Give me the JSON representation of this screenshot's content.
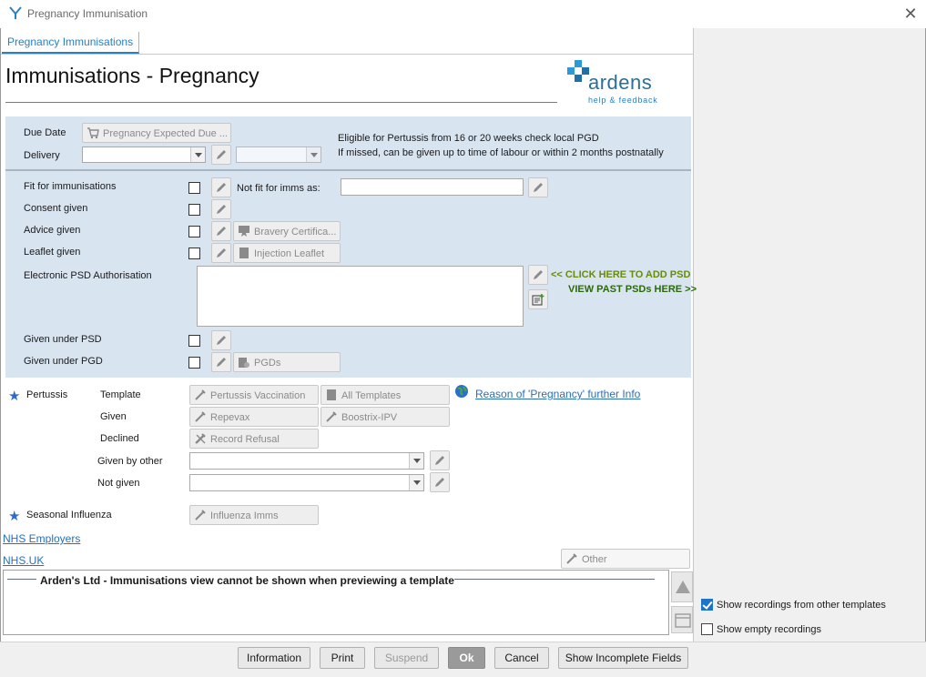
{
  "window": {
    "title": "Pregnancy Immunisation"
  },
  "tab": {
    "label": "Pregnancy Immunisations"
  },
  "header": {
    "title": "Immunisations - Pregnancy",
    "logo_text": "ardens",
    "logo_sub": "help & feedback"
  },
  "due": {
    "due_date_label": "Due Date",
    "due_button": "Pregnancy Expected Due ...",
    "delivery_label": "Delivery",
    "info_line1": "Eligible for Pertussis from 16 or 20 weeks check local PGD",
    "info_line2": "If missed, can be given up to time of labour or within 2 months postnatally"
  },
  "rows": {
    "fit": "Fit for immunisations",
    "not_fit": "Not fit for imms as:",
    "consent": "Consent given",
    "advice": "Advice given",
    "bravery": "Bravery Certifica...",
    "leaflet": "Leaflet given",
    "injection_leaflet": "Injection Leaflet",
    "epsd": "Electronic PSD Authorisation",
    "click_psd": "<< CLICK HERE TO ADD PSD",
    "view_psd": "VIEW PAST PSDs HERE >>",
    "given_psd": "Given under PSD",
    "given_pgd": "Given under PGD",
    "pgds": "PGDs"
  },
  "pertussis": {
    "label": "Pertussis",
    "template": "Template",
    "given": "Given",
    "declined": "Declined",
    "given_by_other": "Given by other",
    "not_given": "Not given",
    "btn_vaccination": "Pertussis Vaccination",
    "btn_all_templates": "All Templates",
    "btn_repevax": "Repevax",
    "btn_boostrix": "Boostrix-IPV",
    "btn_refusal": "Record Refusal",
    "reason_link": "Reason of 'Pregnancy' further Info"
  },
  "influenza": {
    "label": "Seasonal Influenza",
    "btn": "Influenza Imms"
  },
  "links": {
    "nhs_employers": "NHS Employers",
    "nhs_uk": "NHS.UK"
  },
  "other_btn": "Other",
  "preview_msg": "Arden's Ltd - Immunisations view cannot be shown when previewing a template",
  "side": {
    "show_other": "Show recordings from other templates",
    "show_empty": "Show empty recordings",
    "show_other_checked": true,
    "show_empty_checked": false
  },
  "footer": {
    "information": "Information",
    "print": "Print",
    "suspend": "Suspend",
    "ok": "Ok",
    "cancel": "Cancel",
    "show_incomplete": "Show Incomplete Fields"
  }
}
